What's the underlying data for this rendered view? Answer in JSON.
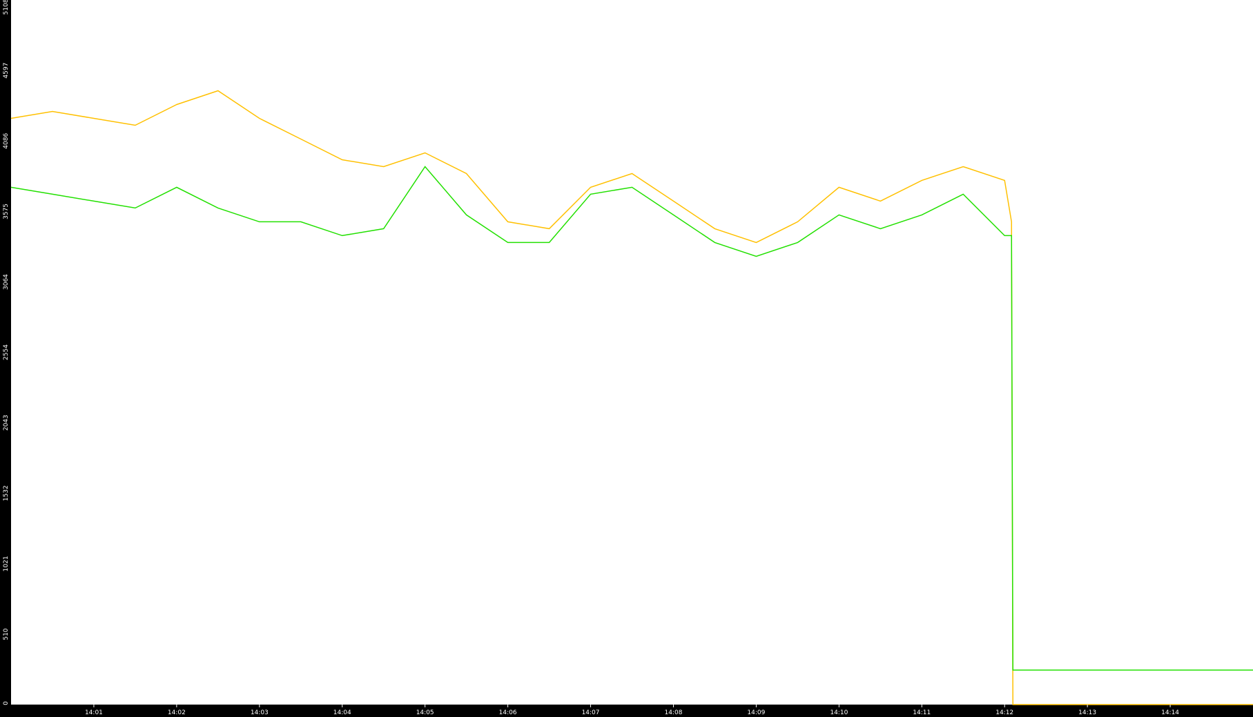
{
  "chart_data": {
    "type": "line",
    "title": "",
    "xlabel": "",
    "ylabel": "",
    "xlim": [
      "14:00:00",
      "14:15:00"
    ],
    "ylim": [
      0,
      5108
    ],
    "y_ticks": [
      "0",
      "510",
      "1021",
      "1532",
      "2043",
      "2554",
      "3064",
      "3575",
      "4086",
      "4597",
      "5108"
    ],
    "x_ticks": [
      "14:01",
      "14:02",
      "14:03",
      "14:04",
      "14:05",
      "14:06",
      "14:07",
      "14:08",
      "14:09",
      "14:10",
      "14:11",
      "14:12",
      "14:13",
      "14:14"
    ],
    "grid": false,
    "legend": "none",
    "series": [
      {
        "color": "#ffc000",
        "x": [
          "14:00:00",
          "14:00:30",
          "14:01:00",
          "14:01:30",
          "14:02:00",
          "14:02:30",
          "14:03:00",
          "14:03:30",
          "14:04:00",
          "14:04:30",
          "14:05:00",
          "14:05:30",
          "14:06:00",
          "14:06:30",
          "14:07:00",
          "14:07:30",
          "14:08:00",
          "14:08:30",
          "14:09:00",
          "14:09:30",
          "14:10:00",
          "14:10:30",
          "14:11:00",
          "14:11:30",
          "14:12:00",
          "14:12:05",
          "14:12:06",
          "14:15:00"
        ],
        "y": [
          4250,
          4300,
          4250,
          4200,
          4350,
          4450,
          4250,
          4100,
          3950,
          3900,
          4000,
          3850,
          3500,
          3450,
          3750,
          3850,
          3650,
          3450,
          3350,
          3500,
          3750,
          3650,
          3800,
          3900,
          3800,
          3500,
          0,
          0
        ]
      },
      {
        "color": "#22e000",
        "x": [
          "14:00:00",
          "14:00:30",
          "14:01:00",
          "14:01:30",
          "14:02:00",
          "14:02:30",
          "14:03:00",
          "14:03:30",
          "14:04:00",
          "14:04:30",
          "14:05:00",
          "14:05:30",
          "14:06:00",
          "14:06:30",
          "14:07:00",
          "14:07:30",
          "14:08:00",
          "14:08:30",
          "14:09:00",
          "14:09:30",
          "14:10:00",
          "14:10:30",
          "14:11:00",
          "14:11:30",
          "14:12:00",
          "14:12:05",
          "14:12:06",
          "14:15:00"
        ],
        "y": [
          3750,
          3700,
          3650,
          3600,
          3750,
          3600,
          3500,
          3500,
          3400,
          3450,
          3900,
          3550,
          3350,
          3350,
          3700,
          3750,
          3550,
          3350,
          3250,
          3350,
          3550,
          3450,
          3550,
          3700,
          3400,
          3400,
          250,
          250
        ]
      }
    ]
  }
}
